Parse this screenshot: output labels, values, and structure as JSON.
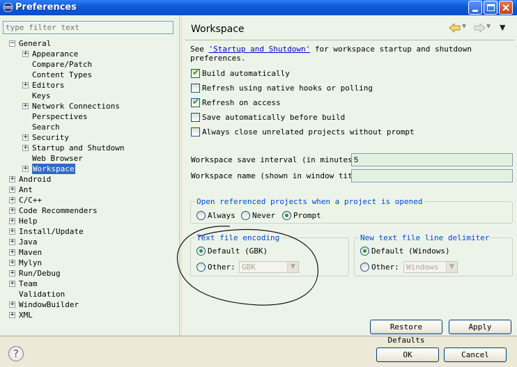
{
  "window": {
    "title": "Preferences"
  },
  "filter": {
    "placeholder": "type filter text"
  },
  "tree": [
    {
      "label": "General",
      "toggle": "−",
      "level": 0
    },
    {
      "label": "Appearance",
      "toggle": "+",
      "level": 1
    },
    {
      "label": "Compare/Patch",
      "toggle": "",
      "level": 1
    },
    {
      "label": "Content Types",
      "toggle": "",
      "level": 1
    },
    {
      "label": "Editors",
      "toggle": "+",
      "level": 1
    },
    {
      "label": "Keys",
      "toggle": "",
      "level": 1
    },
    {
      "label": "Network Connections",
      "toggle": "+",
      "level": 1
    },
    {
      "label": "Perspectives",
      "toggle": "",
      "level": 1
    },
    {
      "label": "Search",
      "toggle": "",
      "level": 1
    },
    {
      "label": "Security",
      "toggle": "+",
      "level": 1
    },
    {
      "label": "Startup and Shutdown",
      "toggle": "+",
      "level": 1
    },
    {
      "label": "Web Browser",
      "toggle": "",
      "level": 1
    },
    {
      "label": "Workspace",
      "toggle": "+",
      "level": 1,
      "selected": true
    },
    {
      "label": "Android",
      "toggle": "+",
      "level": 0
    },
    {
      "label": "Ant",
      "toggle": "+",
      "level": 0
    },
    {
      "label": "C/C++",
      "toggle": "+",
      "level": 0
    },
    {
      "label": "Code Recommenders",
      "toggle": "+",
      "level": 0
    },
    {
      "label": "Help",
      "toggle": "+",
      "level": 0
    },
    {
      "label": "Install/Update",
      "toggle": "+",
      "level": 0
    },
    {
      "label": "Java",
      "toggle": "+",
      "level": 0
    },
    {
      "label": "Maven",
      "toggle": "+",
      "level": 0
    },
    {
      "label": "Mylyn",
      "toggle": "+",
      "level": 0
    },
    {
      "label": "Run/Debug",
      "toggle": "+",
      "level": 0
    },
    {
      "label": "Team",
      "toggle": "+",
      "level": 0
    },
    {
      "label": "Validation",
      "toggle": "",
      "level": 0
    },
    {
      "label": "WindowBuilder",
      "toggle": "+",
      "level": 0
    },
    {
      "label": "XML",
      "toggle": "+",
      "level": 0
    }
  ],
  "page": {
    "title": "Workspace",
    "desc_prefix": "See ",
    "desc_link": "'Startup and Shutdown'",
    "desc_suffix": " for workspace startup and shutdown preferences.",
    "checkboxes": [
      {
        "label": "Build automatically",
        "checked": true
      },
      {
        "label": "Refresh using native hooks or polling",
        "checked": false
      },
      {
        "label": "Refresh on access",
        "checked": true
      },
      {
        "label": "Save automatically before build",
        "checked": false
      },
      {
        "label": "Always close unrelated projects without prompt",
        "checked": false
      }
    ],
    "save_interval_label": "Workspace save interval (in minutes):",
    "save_interval_value": "5",
    "workspace_name_label": "Workspace name (shown in window title):",
    "workspace_name_value": "",
    "open_ref": {
      "title": "Open referenced projects when a project is opened",
      "options": [
        "Always",
        "Never",
        "Prompt"
      ],
      "selected": "Prompt"
    },
    "encoding": {
      "title": "Text file encoding",
      "default_label": "Default (GBK)",
      "other_label": "Other:",
      "other_value": "GBK",
      "selected": "Default"
    },
    "line_delim": {
      "title": "New text file line delimiter",
      "default_label": "Default (Windows)",
      "other_label": "Other:",
      "other_value": "Windows",
      "selected": "Default"
    },
    "restore_defaults": "Restore Defaults",
    "apply": "Apply"
  },
  "footer": {
    "ok": "OK",
    "cancel": "Cancel"
  },
  "icons": {
    "back": "back-arrow-icon",
    "forward": "forward-arrow-icon",
    "menu": "view-menu-icon",
    "help": "help-icon"
  },
  "colors": {
    "selection": "#316ac5",
    "group_title": "#0046d5",
    "check": "#21a121"
  }
}
